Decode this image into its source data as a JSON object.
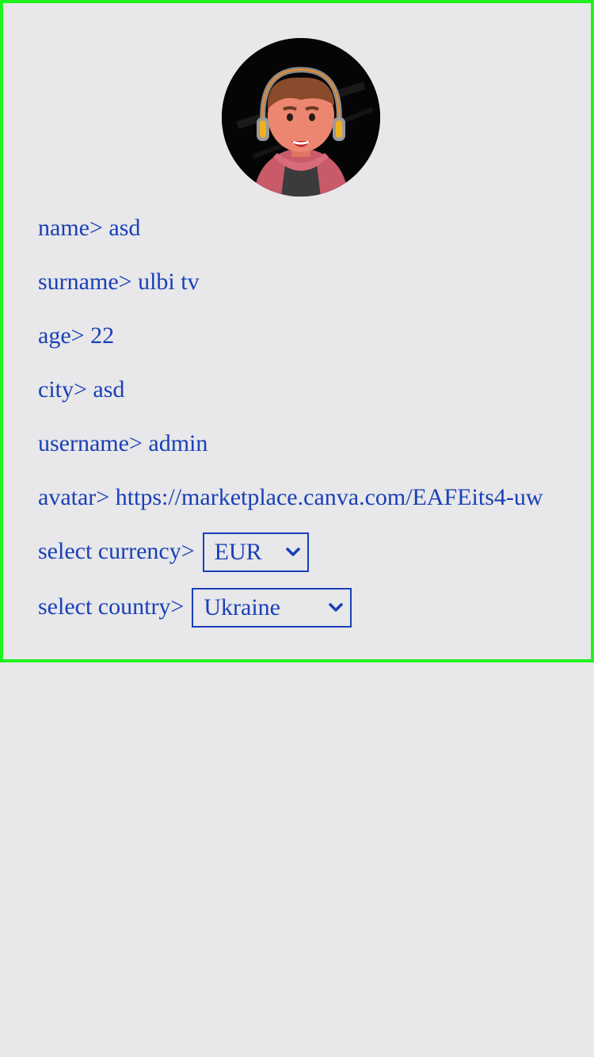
{
  "profile": {
    "avatar_alt": "avatar",
    "fields": [
      {
        "label": "name>",
        "value": "asd"
      },
      {
        "label": "surname>",
        "value": "ulbi tv"
      },
      {
        "label": "age>",
        "value": "22"
      },
      {
        "label": "city>",
        "value": "asd"
      },
      {
        "label": "username>",
        "value": "admin"
      },
      {
        "label": "avatar>",
        "value": "https://marketplace.canva.com/EAFEits4-uw"
      }
    ],
    "currency": {
      "label": "select currency>",
      "selected": "EUR"
    },
    "country": {
      "label": "select country>",
      "selected": "Ukraine"
    }
  },
  "colors": {
    "text": "#1840b8",
    "border": "#1ff21f",
    "background": "#e8e7e9"
  },
  "icons": {
    "select_arrow": "chevron-down-icon"
  }
}
